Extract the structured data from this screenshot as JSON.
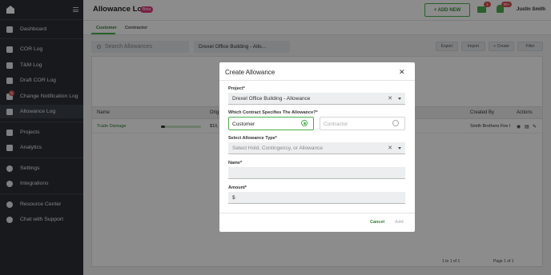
{
  "sidebar": {
    "items": [
      {
        "label": "Dashboard",
        "icon": "home-icon"
      },
      {
        "label": "COR Log",
        "icon": "document-icon"
      },
      {
        "label": "T&M Log",
        "icon": "document-icon"
      },
      {
        "label": "Draft COR Log",
        "icon": "pencil-icon"
      },
      {
        "label": "Change Notification Log",
        "icon": "notification-icon",
        "badge": "5"
      },
      {
        "label": "Allowance Log",
        "icon": "allowance-icon"
      },
      {
        "label": "Projects",
        "icon": "building-icon"
      },
      {
        "label": "Analytics",
        "icon": "chart-icon"
      },
      {
        "label": "Settings",
        "icon": "gear-icon"
      },
      {
        "label": "Integrations",
        "icon": "integration-icon"
      },
      {
        "label": "Resource Center",
        "icon": "help-icon"
      },
      {
        "label": "Chat with Support",
        "icon": "chat-icon"
      }
    ]
  },
  "header": {
    "title": "Allowance Log",
    "badge": "Beta",
    "add_new": "+ ADD NEW",
    "mail_count": "1",
    "bell_count": "99+",
    "user": "Justin Smith"
  },
  "tabs": [
    "Customer",
    "Contractor"
  ],
  "toolbar": {
    "search_placeholder": "Search Allowances",
    "project": "Drexel Office Building - Allo...",
    "export": "Export",
    "import": "Import",
    "create": "+ Create",
    "filter": "Filter"
  },
  "table": {
    "columns": [
      "Name",
      "Orig",
      "Created By",
      "Actions"
    ],
    "rows": [
      {
        "name": "Trade Damage",
        "progress": 0.1,
        "orig": "$10,",
        "created_by": "Smith Brothers Fire I"
      }
    ],
    "pagination": "1 to 1 of 1",
    "page": "Page 1 of 1"
  },
  "modal": {
    "title": "Create Allowance",
    "project_label": "Project*",
    "project_value": "Drexel Office Building - Allowance",
    "contract_label": "Which Contract Specifies The Allowance?*",
    "option_customer": "Customer",
    "option_contractor": "Contractor",
    "type_label": "Select Allowance Type*",
    "type_placeholder": "Select Hold, Contingency, or Allowance",
    "name_label": "Name*",
    "amount_label": "Amount*",
    "amount_prefix": "$",
    "cancel": "Cancel",
    "add": "Add"
  },
  "colors": {
    "accent": "#4caf50",
    "sidebar": "#2b2f36",
    "badge": "#d9534f",
    "beta": "#e0397e"
  }
}
